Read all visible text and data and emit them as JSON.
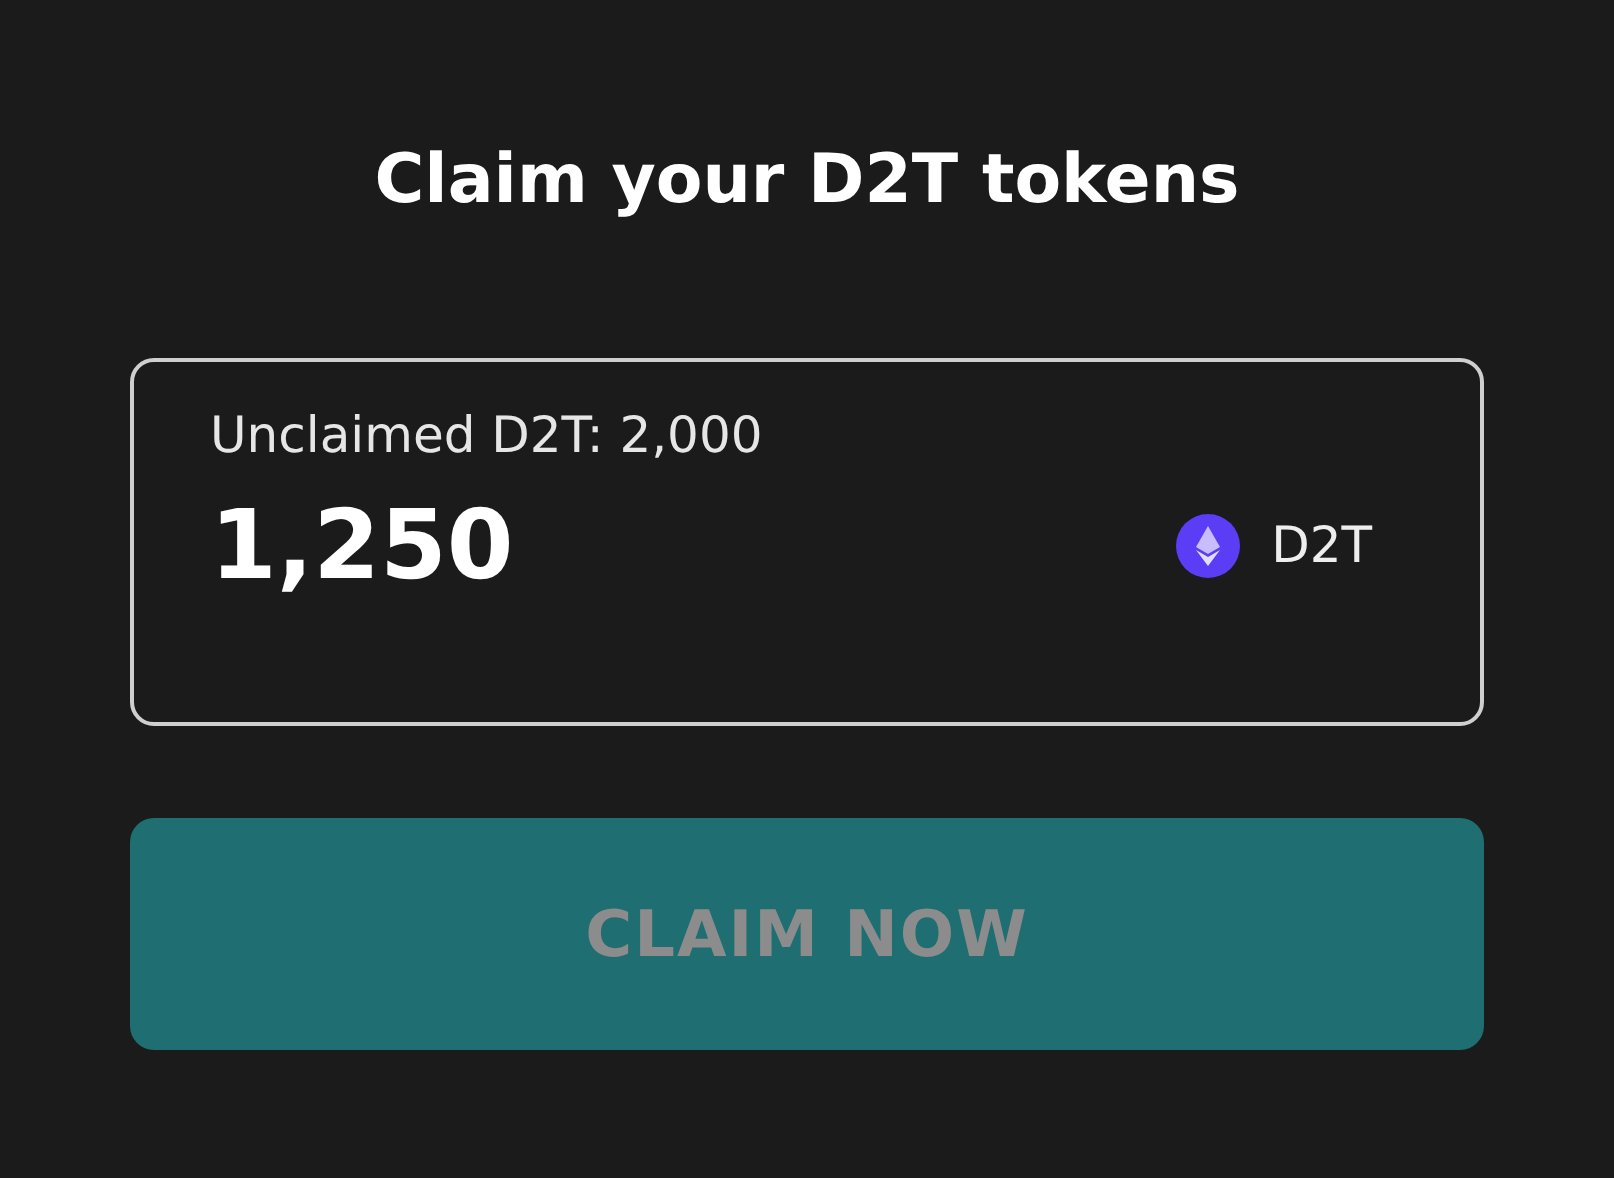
{
  "title": "Claim your D2T tokens",
  "claim_box": {
    "unclaimed_label": "Unclaimed D2T: 2,000",
    "amount": "1,250",
    "token": "D2T"
  },
  "claim_button": {
    "label": "CLAIM NOW",
    "disabled": true
  }
}
